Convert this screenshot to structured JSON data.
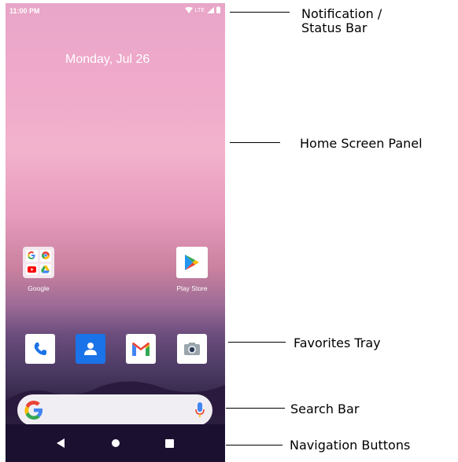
{
  "status_bar": {
    "time": "11:00 PM",
    "network": "LTE"
  },
  "home": {
    "date": "Monday, Jul 26"
  },
  "apps": [
    {
      "name": "Google"
    },
    {
      "name": "Play Store"
    }
  ],
  "callouts": {
    "notification_line1": "Notification /",
    "notification_line2": "Status Bar",
    "home_panel": "Home Screen Panel",
    "favorites": "Favorites Tray",
    "search": "Search Bar",
    "navigation": "Navigation Buttons"
  },
  "colors": {
    "google_blue": "#4285f4",
    "google_red": "#ea4335",
    "google_yellow": "#fbbc05",
    "google_green": "#34a853"
  }
}
